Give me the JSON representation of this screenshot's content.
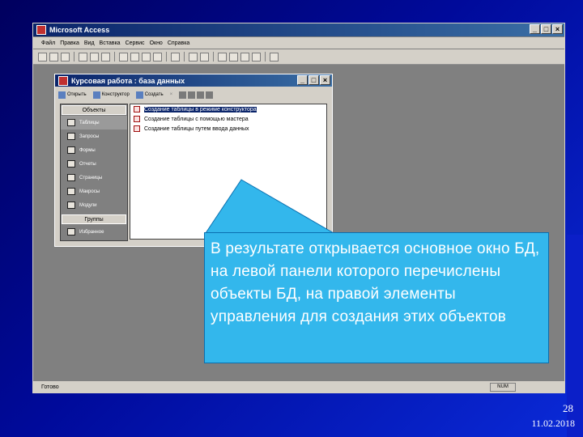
{
  "access_window": {
    "title": "Microsoft Access",
    "menu": [
      "Файл",
      "Правка",
      "Вид",
      "Вставка",
      "Сервис",
      "Окно",
      "Справка"
    ],
    "status_text": "Готово",
    "status_indicator": "NUM"
  },
  "db_window": {
    "title": "Курсовая работа : база данных",
    "toolbar": {
      "open": "Открыть",
      "design": "Конструктор",
      "create": "Создать"
    },
    "objects_header": "Объекты",
    "objects": [
      {
        "label": "Таблицы",
        "icon": "table-icon"
      },
      {
        "label": "Запросы",
        "icon": "query-icon"
      },
      {
        "label": "Формы",
        "icon": "form-icon"
      },
      {
        "label": "Отчеты",
        "icon": "report-icon"
      },
      {
        "label": "Страницы",
        "icon": "page-icon"
      },
      {
        "label": "Макросы",
        "icon": "macro-icon"
      },
      {
        "label": "Модули",
        "icon": "module-icon"
      }
    ],
    "groups_header": "Группы",
    "groups": [
      {
        "label": "Избранное",
        "icon": "favorites-icon"
      }
    ],
    "list_items": [
      "Создание таблицы в режиме конструктора",
      "Создание таблицы с помощью мастера",
      "Создание таблицы путем ввода данных"
    ]
  },
  "callout": {
    "text": "В результате открывается основное окно БД, на левой панели которого перечислены объекты БД, на правой элементы управления для создания этих объектов"
  },
  "slide": {
    "number": "28",
    "date": "11.02.2018"
  },
  "colors": {
    "background": "#000a9a",
    "callout": "#33b7ec",
    "titlebar": "#0a246a"
  }
}
